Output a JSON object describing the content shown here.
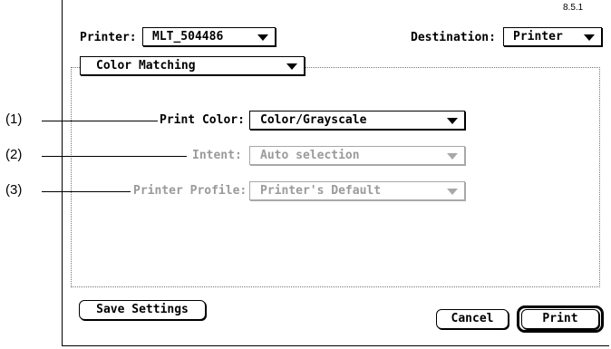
{
  "dialog": {
    "version": "8.5.1",
    "printer_label": "Printer:",
    "printer_value": "MLT_504486",
    "destination_label": "Destination:",
    "destination_value": "Printer",
    "panel_menu_value": "Color Matching"
  },
  "settings": {
    "print_color_label": "Print Color:",
    "print_color_value": "Color/Grayscale",
    "intent_label": "Intent:",
    "intent_value": "Auto selection",
    "printer_profile_label": "Printer Profile:",
    "printer_profile_value": "Printer's Default"
  },
  "callouts": [
    "(1)",
    "(2)",
    "(3)"
  ],
  "buttons": {
    "save_settings": "Save Settings",
    "cancel": "Cancel",
    "print": "Print"
  },
  "icons": {
    "popup_arrow": "chevron-down-icon"
  }
}
